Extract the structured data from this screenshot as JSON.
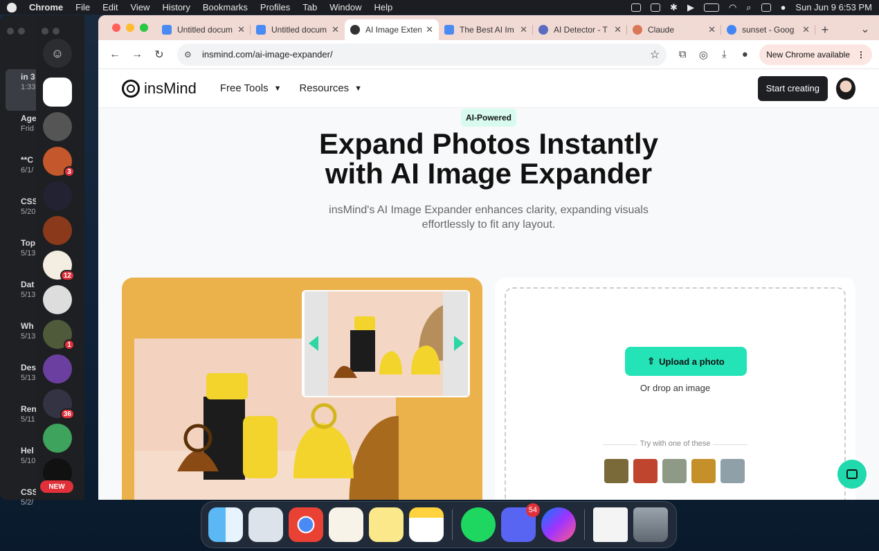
{
  "menubar": {
    "app": "Chrome",
    "menus": [
      "File",
      "Edit",
      "View",
      "History",
      "Bookmarks",
      "Profiles",
      "Tab",
      "Window",
      "Help"
    ],
    "datetime": "Sun Jun 9  6:53 PM"
  },
  "notes_sidebar": [
    {
      "title": "in 3",
      "sub": "1:33"
    },
    {
      "title": "Age",
      "sub": "Frid"
    },
    {
      "title": "**C",
      "sub": "6/1/"
    },
    {
      "title": "CSS",
      "sub": "5/20"
    },
    {
      "title": "Top",
      "sub": "5/13"
    },
    {
      "title": "Dat",
      "sub": "5/13"
    },
    {
      "title": "Wh",
      "sub": "5/13"
    },
    {
      "title": "Des",
      "sub": "5/13"
    },
    {
      "title": "Ren",
      "sub": "5/11"
    },
    {
      "title": "Hel",
      "sub": "5/10"
    },
    {
      "title": "CSS",
      "sub": "5/2/"
    }
  ],
  "discord": {
    "badges": {
      "srv3": "3",
      "srv6": "12",
      "srv9": "1",
      "srv11": "36"
    },
    "new_label": "NEW"
  },
  "tabs": [
    {
      "title": "Untitled docum",
      "color": "#4a8af4"
    },
    {
      "title": "Untitled docum",
      "color": "#4a8af4"
    },
    {
      "title": "AI Image Exten",
      "color": "#333333"
    },
    {
      "title": "The Best AI Im",
      "color": "#4a8af4"
    },
    {
      "title": "AI Detector - T",
      "color": "#5b6bc0"
    },
    {
      "title": "Claude",
      "color": "#d97757"
    },
    {
      "title": "sunset - Goog",
      "color": "#4285f4"
    }
  ],
  "toolbar": {
    "url": "insmind.com/ai-image-expander/",
    "update_label": "New Chrome available"
  },
  "site": {
    "logo": "insMind",
    "nav": [
      "Free Tools",
      "Resources"
    ],
    "cta": "Start creating"
  },
  "hero": {
    "pill": "AI-Powered",
    "title_line1": "Expand Photos Instantly",
    "title_line2": "with AI Image Expander",
    "sub_line1": "insMind's AI Image Expander enhances clarity, expanding visuals",
    "sub_line2": "effortlessly to fit any layout."
  },
  "upload": {
    "button": "Upload a photo",
    "drop": "Or drop an image",
    "try": "Try with one of these"
  },
  "dock": {
    "discord_badge": "54"
  },
  "colors": {
    "accent": "#24e3b6",
    "card_bg": "#ebb24c",
    "tabbar": "#f1d9d4"
  }
}
